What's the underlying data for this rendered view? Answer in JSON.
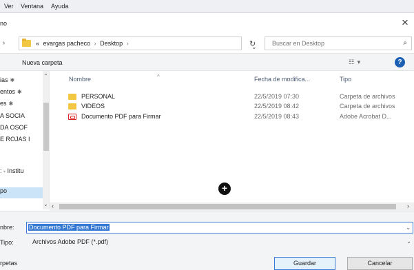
{
  "menu": {
    "items": [
      "Ver",
      "Ventana",
      "Ayuda"
    ]
  },
  "dialog": {
    "title": "no"
  },
  "address": {
    "prefix": "«",
    "path": [
      "evargas pacheco",
      "Desktop"
    ]
  },
  "search": {
    "placeholder": "Buscar en Desktop"
  },
  "toolbar": {
    "new_folder": "Nueva carpeta"
  },
  "nav": {
    "items": [
      {
        "label": "ias",
        "pinned": true
      },
      {
        "label": "entos",
        "pinned": true
      },
      {
        "label": "es",
        "pinned": true
      },
      {
        "label": "A SOCIA",
        "pinned": false
      },
      {
        "label": "DA OSOF",
        "pinned": false
      },
      {
        "label": "E ROJAS I",
        "pinned": false
      },
      {
        "label": ": - Institu",
        "pinned": false
      },
      {
        "label": "po",
        "pinned": false,
        "selected": true
      }
    ]
  },
  "files": {
    "columns": {
      "name": "Nombre",
      "date": "Fecha de modifica...",
      "type": "Tipo"
    },
    "rows": [
      {
        "icon": "folder-icon",
        "name": "PERSONAL",
        "date": "22/5/2019 07:30",
        "type": "Carpeta de archivos"
      },
      {
        "icon": "folder-icon",
        "name": "VIDEOS",
        "date": "22/5/2019 08:42",
        "type": "Carpeta de archivos"
      },
      {
        "icon": "pdf-icon",
        "name": "Documento PDF para Firmar",
        "date": "22/5/2019 08:43",
        "type": "Adobe Acrobat D..."
      }
    ]
  },
  "fields": {
    "name_label": "nbre:",
    "name_value": "Documento PDF para Firmar",
    "type_label": "Tipo:",
    "type_value": "Archivos Adobe PDF (*.pdf)"
  },
  "footer": {
    "hide_folders": "rpetas",
    "save": "Guardar",
    "cancel": "Cancelar"
  },
  "colors": {
    "accent": "#3478d4",
    "help": "#1a5fb4",
    "folder": "#f2c744",
    "pdf": "#dd2222"
  }
}
